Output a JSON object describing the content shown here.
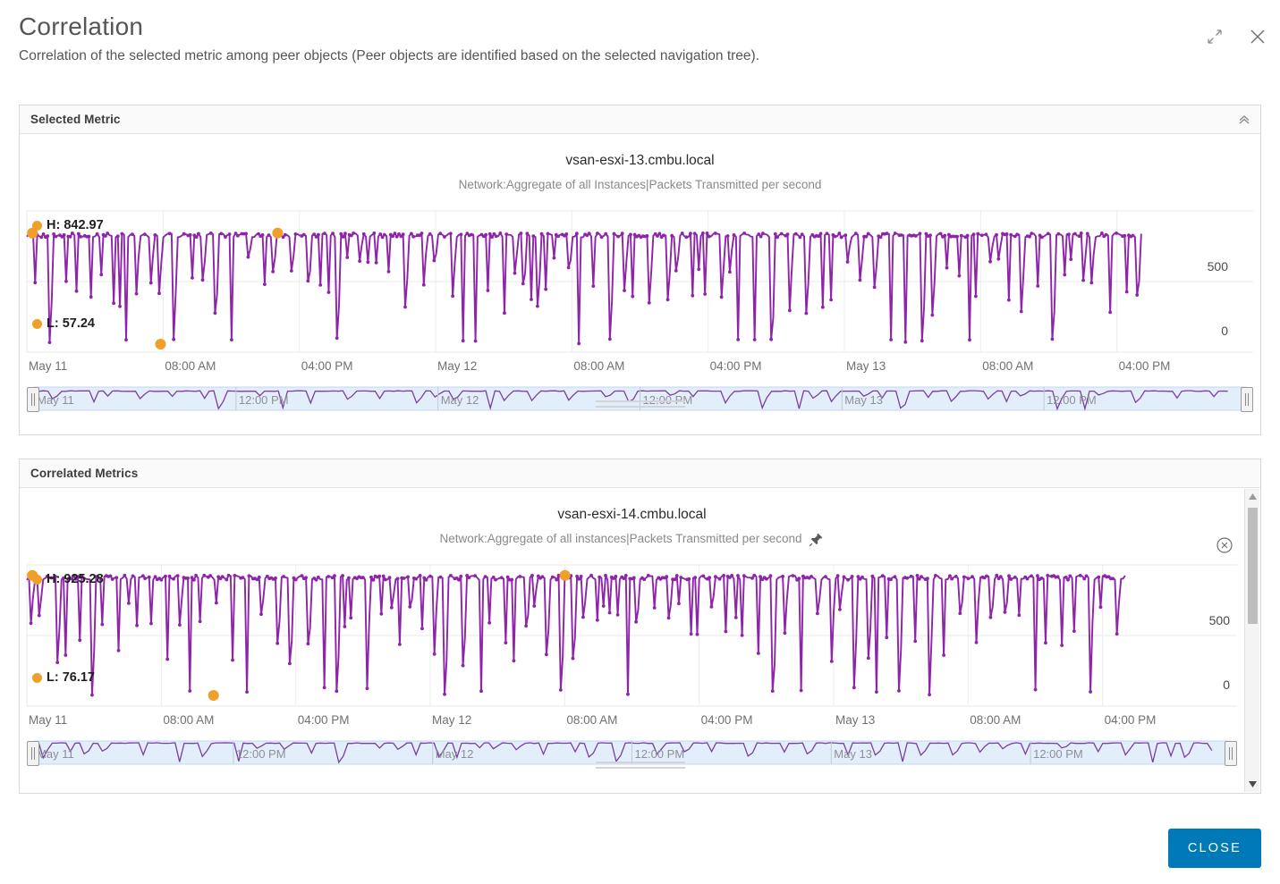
{
  "header": {
    "title": "Correlation",
    "subtitle": "Correlation of the selected metric among peer objects (Peer objects are identified based on the selected navigation tree).",
    "expand_icon": "expand-icon",
    "close_icon": "close-icon"
  },
  "panels": {
    "selected": {
      "title": "Selected Metric",
      "collapse_icon": "double-chevron-up-icon"
    },
    "correlated": {
      "title": "Correlated Metrics"
    }
  },
  "footer": {
    "close_label": "CLOSE"
  },
  "colors": {
    "line": "#8e24aa",
    "marker": "#f0a02a",
    "accent": "#0079b8",
    "brush_selection": "#e3eefb",
    "grid": "#e6e6e6"
  },
  "chart_data": [
    {
      "type": "line",
      "id": "selected-metric-chart",
      "title": "vsan-esxi-13.cmbu.local",
      "subtitle": "Network:Aggregate of all Instances|Packets Transmitted per second",
      "xlabel": "",
      "ylabel": "",
      "ylim": [
        0,
        1000
      ],
      "yticks": [
        0,
        500
      ],
      "ytick_labels": [
        "0",
        "500"
      ],
      "grid": true,
      "legend": "none",
      "high_label": "H: 842.97",
      "high_value": 842.97,
      "low_label": "L: 57.24",
      "low_value": 57.24,
      "xtick_labels": [
        "May 11",
        "08:00 AM",
        "04:00 PM",
        "May 12",
        "08:00 AM",
        "04:00 PM",
        "May 13",
        "08:00 AM",
        "04:00 PM"
      ],
      "brush": {
        "tick_labels": [
          "May 11",
          "12:00 PM",
          "May 12",
          "12:00 PM",
          "May 13",
          "12:00 PM"
        ],
        "selection_start_pct": 0,
        "selection_end_pct": 100
      },
      "series": [
        {
          "name": "Packets Transmitted per second",
          "color": "#8e24aa",
          "description": "Dense spiky time series oscillating between a ~840 baseline and frequent sharp dips toward 60-400; samples every few minutes across May 11 00:00 to May 13 ~10:00",
          "baseline": 842.97,
          "min": 57.24,
          "max": 842.97
        }
      ],
      "markers": [
        {
          "label": "H",
          "value": 842.97,
          "x_pct": 0.5,
          "color": "#f0a02a"
        },
        {
          "label": "H2",
          "value": 842.97,
          "x_pct": 22.5,
          "color": "#f0a02a"
        },
        {
          "label": "L",
          "value": 57.24,
          "x_pct": 12.0,
          "color": "#f0a02a"
        }
      ]
    },
    {
      "type": "line",
      "id": "correlated-metric-chart",
      "title": "vsan-esxi-14.cmbu.local",
      "subtitle": "Network:Aggregate of all instances|Packets Transmitted per second",
      "pin_icon": "pin-icon",
      "remove_icon": "remove-circle-icon",
      "xlabel": "",
      "ylabel": "",
      "ylim": [
        0,
        1000
      ],
      "yticks": [
        0,
        500
      ],
      "ytick_labels": [
        "0",
        "500"
      ],
      "grid": true,
      "legend": "none",
      "high_label": "H: 925.28",
      "high_value": 925.28,
      "low_label": "L: 76.17",
      "low_value": 76.17,
      "xtick_labels": [
        "May 11",
        "08:00 AM",
        "04:00 PM",
        "May 12",
        "08:00 AM",
        "04:00 PM",
        "May 13",
        "08:00 AM",
        "04:00 PM"
      ],
      "brush": {
        "tick_labels": [
          "May 11",
          "12:00 PM",
          "May 12",
          "12:00 PM",
          "May 13",
          "12:00 PM"
        ],
        "selection_start_pct": 0,
        "selection_end_pct": 100
      },
      "series": [
        {
          "name": "Packets Transmitted per second",
          "color": "#8e24aa",
          "description": "Dense spiky time series oscillating between a ~925 baseline and frequent sharp dips toward 76-450; samples every few minutes across May 11 00:00 to May 13 ~10:00",
          "baseline": 925.28,
          "min": 76.17,
          "max": 925.28
        }
      ],
      "markers": [
        {
          "label": "H",
          "value": 925.28,
          "x_pct": 0.5,
          "color": "#f0a02a"
        },
        {
          "label": "H2",
          "value": 925.28,
          "x_pct": 49.0,
          "color": "#f0a02a"
        },
        {
          "label": "L",
          "value": 76.17,
          "x_pct": 17.0,
          "color": "#f0a02a"
        }
      ]
    }
  ]
}
